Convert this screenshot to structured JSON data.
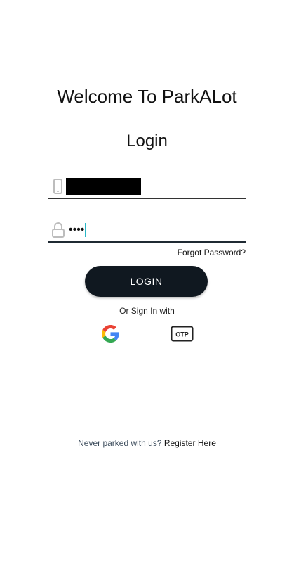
{
  "header": {
    "title": "Welcome To ParkALot",
    "subtitle": "Login"
  },
  "form": {
    "phone_icon": "phone-icon",
    "phone_value_redacted": true,
    "password_icon": "lock-icon",
    "password_value": "••••",
    "forgot_label": "Forgot Password?",
    "login_label": "LOGIN"
  },
  "alt_signin": {
    "label": "Or Sign In with",
    "providers": [
      {
        "name": "google",
        "icon": "google-icon"
      },
      {
        "name": "otp",
        "icon": "otp-icon",
        "text": "OTP"
      }
    ]
  },
  "footer": {
    "prompt": "Never parked with us?",
    "link": "Register Here"
  },
  "colors": {
    "button_bg": "#101820",
    "caret": "#29b6c6"
  }
}
